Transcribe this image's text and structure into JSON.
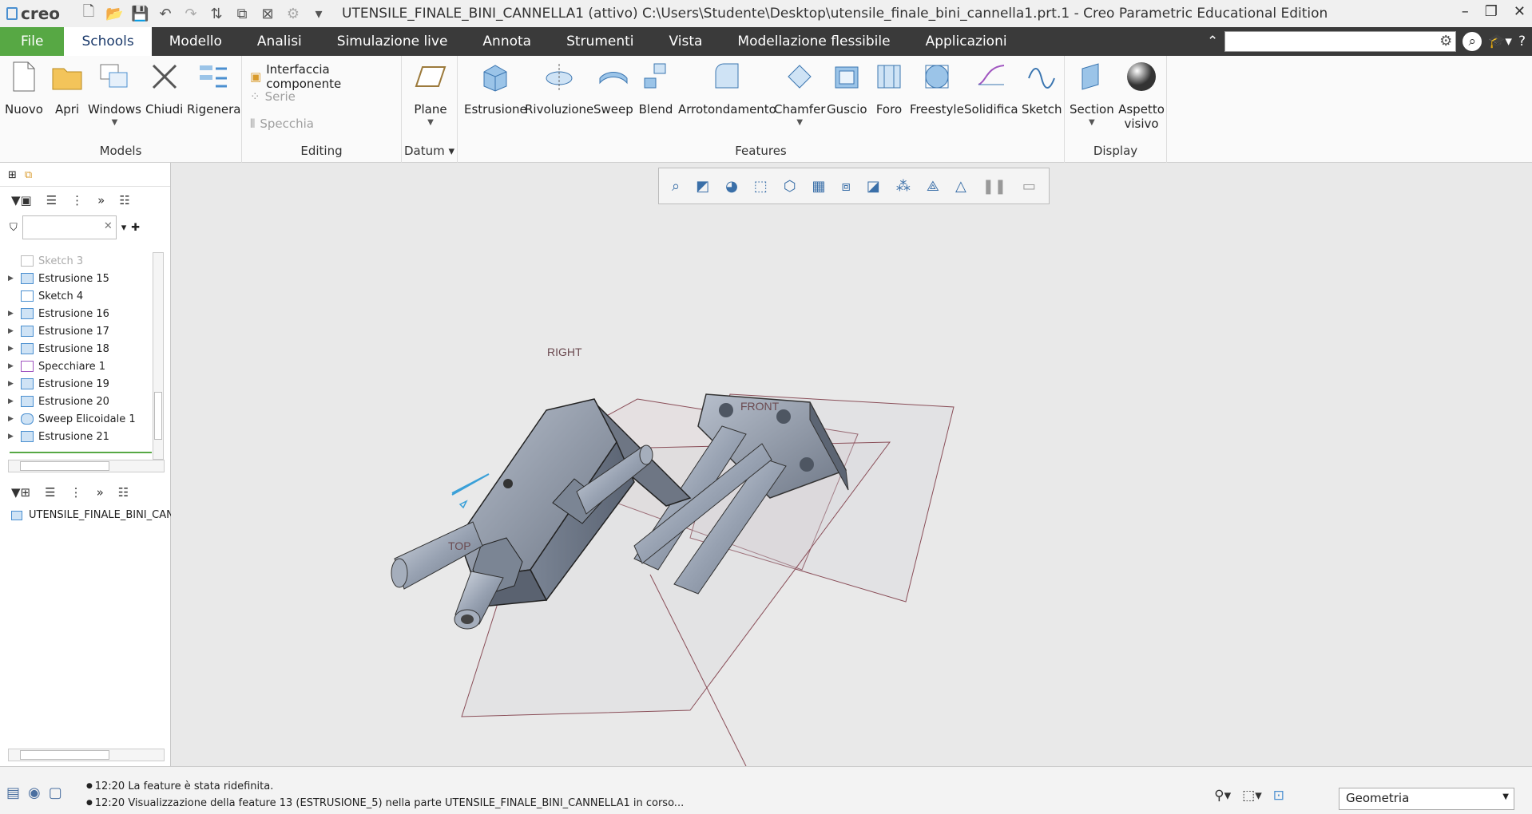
{
  "app": {
    "logo": "creo",
    "title": "UTENSILE_FINALE_BINI_CANNELLA1 (attivo) C:\\Users\\Studente\\Desktop\\utensile_finale_bini_cannella1.prt.1 - Creo Parametric Educational Edition"
  },
  "menu": {
    "tabs": [
      "File",
      "Schools",
      "Modello",
      "Analisi",
      "Simulazione live",
      "Annota",
      "Strumenti",
      "Vista",
      "Modellazione flessibile",
      "Applicazioni"
    ]
  },
  "ribbon": {
    "models": {
      "label": "Models",
      "buttons": [
        "Nuovo",
        "Apri",
        "Windows",
        "Chiudi",
        "Rigenera"
      ]
    },
    "editing": {
      "label": "Editing",
      "items": [
        "Interfaccia componente",
        "Serie",
        "Specchia"
      ]
    },
    "datum": {
      "label": "Datum",
      "button": "Plane"
    },
    "features": {
      "label": "Features",
      "buttons": [
        "Estrusione",
        "Rivoluzione",
        "Sweep",
        "Blend",
        "Arrotondamento",
        "Chamfer",
        "Guscio",
        "Foro",
        "Freestyle",
        "Solidifica",
        "Sketch"
      ]
    },
    "display": {
      "label": "Display",
      "buttons": [
        "Section",
        "Aspetto visivo"
      ]
    }
  },
  "tree": {
    "items": [
      {
        "label": "Sketch 3",
        "dim": true
      },
      {
        "label": "Estrusione 15"
      },
      {
        "label": "Sketch 4"
      },
      {
        "label": "Estrusione 16"
      },
      {
        "label": "Estrusione 17"
      },
      {
        "label": "Estrusione 18"
      },
      {
        "label": "Specchiare 1"
      },
      {
        "label": "Estrusione 19"
      },
      {
        "label": "Estrusione 20"
      },
      {
        "label": "Sweep Elicoidale 1"
      },
      {
        "label": "Estrusione 21"
      }
    ],
    "layer_item": "UTENSILE_FINALE_BINI_CANN"
  },
  "viewport": {
    "planes": [
      "RIGHT",
      "FRONT",
      "TOP"
    ]
  },
  "status": {
    "messages": [
      "12:20 La feature è stata ridefinita.",
      "12:20 Visualizzazione della feature 13 (ESTRUSIONE_5) nella parte UTENSILE_FINALE_BINI_CANNELLA1 in corso..."
    ],
    "filter": "Geometria"
  }
}
